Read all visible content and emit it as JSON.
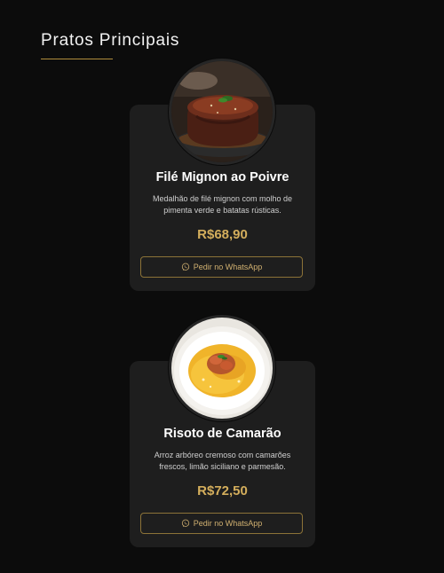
{
  "section": {
    "title": "Pratos Principais",
    "accent_color": "#b08d3c"
  },
  "dishes": [
    {
      "name": "Filé Mignon ao Poivre",
      "description": "Medalhão de filé mignon com molho de pimenta verde e batatas rústicas.",
      "price": "R$68,90",
      "button_label": "Pedir no WhatsApp",
      "button_icon": "whatsapp-icon",
      "photo": "steak-photo"
    },
    {
      "name": "Risoto de Camarão",
      "description": "Arroz arbóreo cremoso com camarões frescos, limão siciliano e parmesão.",
      "price": "R$72,50",
      "button_label": "Pedir no WhatsApp",
      "button_icon": "whatsapp-icon",
      "photo": "risotto-photo"
    }
  ],
  "colors": {
    "background": "#0c0c0c",
    "card": "#1e1e1e",
    "price": "#d4ae5c",
    "button_border": "#8c7338"
  }
}
